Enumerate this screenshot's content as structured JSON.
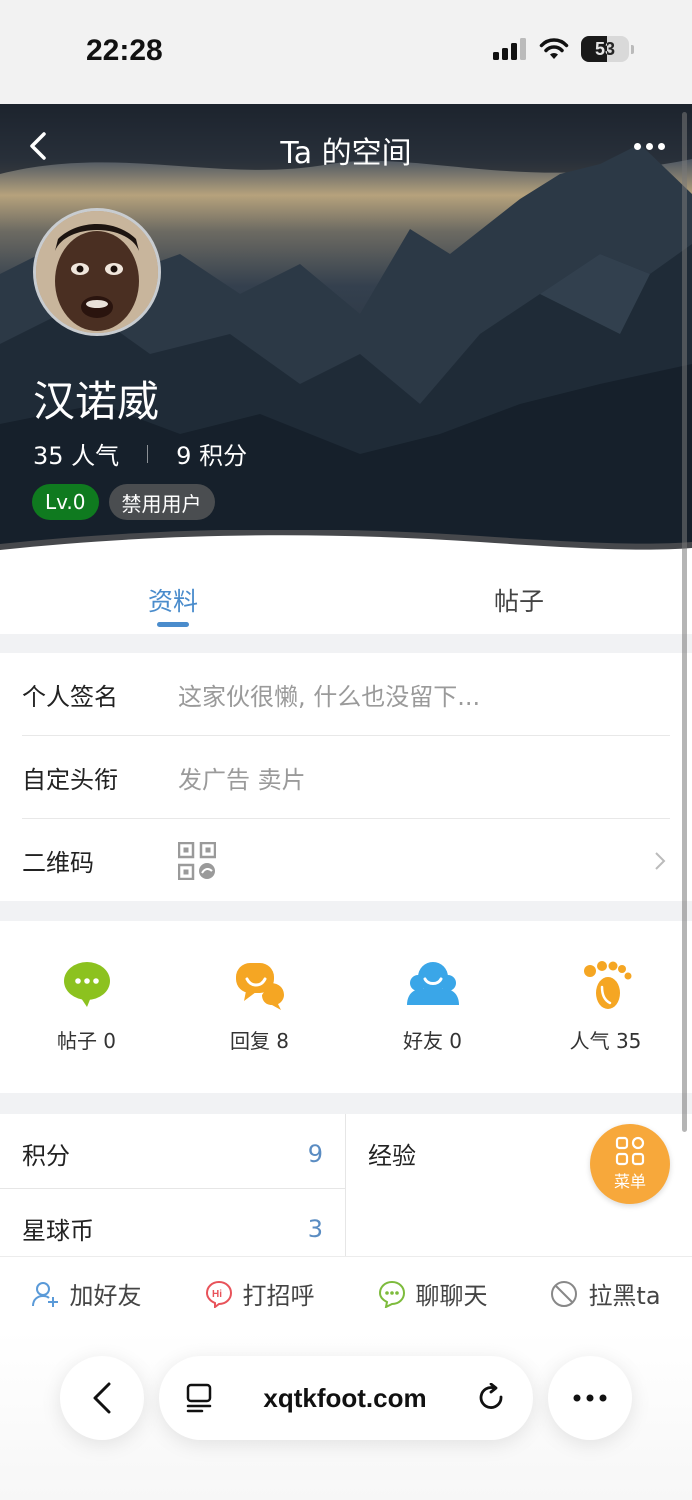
{
  "status_bar": {
    "time": "22:28",
    "battery": "53"
  },
  "header": {
    "title": "Ta 的空间"
  },
  "profile": {
    "name": "汉诺威",
    "popularity_text": "35 人气",
    "points_text": "9 积分",
    "level_badge": "Lv.0",
    "role_badge": "禁用用户"
  },
  "tabs": [
    {
      "label": "资料",
      "active": true
    },
    {
      "label": "帖子",
      "active": false
    }
  ],
  "info": {
    "signature_label": "个人签名",
    "signature_value": "这家伙很懒, 什么也没留下...",
    "title_label": "自定头衔",
    "title_value": "发广告 卖片",
    "qrcode_label": "二维码"
  },
  "stats": [
    {
      "label": "帖子 0",
      "icon": "chat-bubble-icon",
      "color": "#8cc21f"
    },
    {
      "label": "回复 8",
      "icon": "reply-bubble-icon",
      "color": "#f5a623"
    },
    {
      "label": "好友 0",
      "icon": "friends-icon",
      "color": "#3aa6e8"
    },
    {
      "label": "人气 35",
      "icon": "footprint-icon",
      "color": "#f5a623"
    }
  ],
  "points": {
    "score_label": "积分",
    "score_value": "9",
    "exp_label": "经验",
    "coin_label": "星球币",
    "coin_value": "3"
  },
  "menu_fab": {
    "label": "菜单"
  },
  "actions": [
    {
      "label": "加好友",
      "icon": "add-friend-icon"
    },
    {
      "label": "打招呼",
      "icon": "hi-icon"
    },
    {
      "label": "聊聊天",
      "icon": "chat-icon"
    },
    {
      "label": "拉黑ta",
      "icon": "block-icon"
    }
  ],
  "browser": {
    "url": "xqtkfoot.com"
  }
}
